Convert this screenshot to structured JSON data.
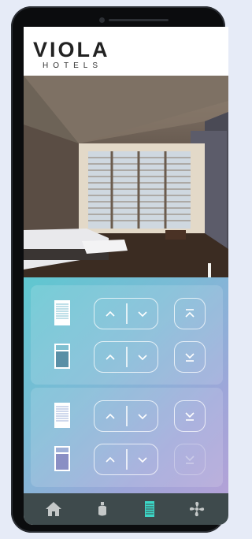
{
  "brand": {
    "name": "VIOLA",
    "subtitle": "HOTELS"
  },
  "colors": {
    "accent": "#3cd6c6",
    "panel_gradient_start": "#5fc7d0",
    "panel_gradient_end": "#b3a2d7",
    "nav_bg": "#3e4a4c",
    "nav_icon": "#c4c8c8"
  },
  "groups": [
    {
      "rows": [
        {
          "icon": "blind-open-icon",
          "controls": [
            "chevron-up-icon",
            "chevron-down-icon"
          ],
          "extra": "move-to-top-icon"
        },
        {
          "icon": "blind-closed-icon",
          "controls": [
            "chevron-up-icon",
            "chevron-down-icon"
          ],
          "extra": "move-to-bottom-icon"
        }
      ]
    },
    {
      "rows": [
        {
          "icon": "blind-open-icon",
          "controls": [
            "chevron-up-icon",
            "chevron-down-icon"
          ],
          "extra": "move-to-bottom-icon"
        },
        {
          "icon": "blind-closed-icon",
          "controls": [
            "chevron-up-icon",
            "chevron-down-icon"
          ],
          "extra": "move-to-bottom-icon-disabled"
        }
      ]
    }
  ],
  "nav": [
    {
      "icon": "home-icon",
      "active": false
    },
    {
      "icon": "lamp-icon",
      "active": false
    },
    {
      "icon": "blinds-icon",
      "active": true
    },
    {
      "icon": "fan-icon",
      "active": false
    }
  ]
}
